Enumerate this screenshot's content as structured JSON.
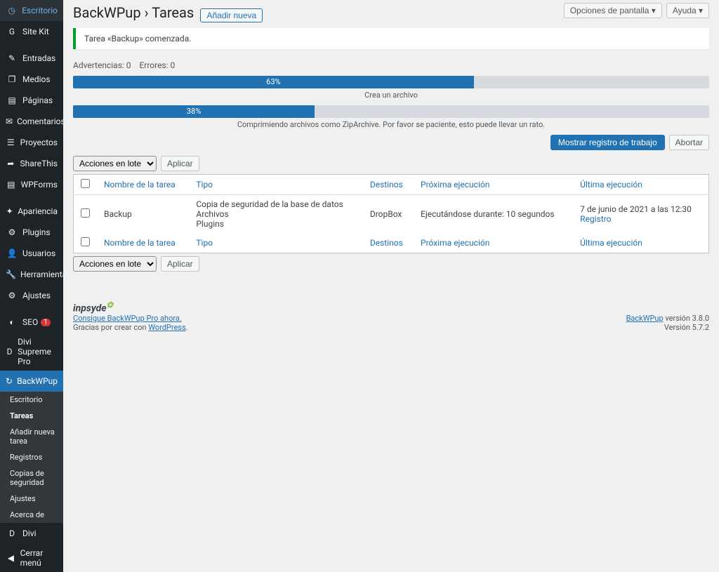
{
  "topbar": {
    "screen_options": "Opciones de pantalla",
    "help": "Ayuda"
  },
  "header": {
    "plugin": "BackWPup",
    "separator": "›",
    "page": "Tareas",
    "add_new": "Añadir nueva"
  },
  "notice": "Tarea «Backup» comenzada.",
  "stats": {
    "warnings_label": "Advertencias:",
    "warnings_count": "0",
    "errors_label": "Errores:",
    "errors_count": "0"
  },
  "progress1": {
    "percent": "63%",
    "caption": "Crea un archivo"
  },
  "progress2": {
    "percent": "38%",
    "caption": "Comprimiendo archivos como ZipArchive. Por favor se paciente, esto puede llevar un rato."
  },
  "job_actions": {
    "show_log": "Mostrar registro de trabajo",
    "abort": "Abortar"
  },
  "bulk": {
    "placeholder": "Acciones en lote",
    "apply": "Aplicar"
  },
  "table": {
    "cols": {
      "name": "Nombre de la tarea",
      "type": "Tipo",
      "dest": "Destinos",
      "next": "Próxima ejecución",
      "last": "Última ejecución"
    },
    "row": {
      "name": "Backup",
      "type1": "Copia de seguridad de la base de datos",
      "type2": "Archivos",
      "type3": "Plugins",
      "dest": "DropBox",
      "next": "Ejecutándose durante: 10 segundos",
      "last_date": "7 de junio de 2021 a las 12:30",
      "last_log": "Registro"
    }
  },
  "sidebar": {
    "items": [
      {
        "icon": "◷",
        "label": "Escritorio"
      },
      {
        "icon": "G",
        "label": "Site Kit"
      },
      {
        "icon": "✎",
        "label": "Entradas"
      },
      {
        "icon": "❐",
        "label": "Medios"
      },
      {
        "icon": "▤",
        "label": "Páginas"
      },
      {
        "icon": "✉",
        "label": "Comentarios"
      },
      {
        "icon": "☰",
        "label": "Proyectos"
      },
      {
        "icon": "➦",
        "label": "ShareThis"
      },
      {
        "icon": "▤",
        "label": "WPForms"
      },
      {
        "icon": "✦",
        "label": "Apariencia"
      },
      {
        "icon": "⚙",
        "label": "Plugins"
      },
      {
        "icon": "👤",
        "label": "Usuarios"
      },
      {
        "icon": "🔧",
        "label": "Herramientas"
      },
      {
        "icon": "⚙",
        "label": "Ajustes"
      },
      {
        "icon": "◐",
        "label": "SEO",
        "badge": "1"
      },
      {
        "icon": "D",
        "label": "Divi Supreme Pro"
      },
      {
        "icon": "↻",
        "label": "BackWPup",
        "current": true
      },
      {
        "icon": "D",
        "label": "Divi"
      },
      {
        "icon": "◀",
        "label": "Cerrar menú"
      }
    ],
    "submenu": [
      "Escritorio",
      "Tareas",
      "Añadir nueva tarea",
      "Registros",
      "Copias de seguridad",
      "Ajustes",
      "Acerca de"
    ]
  },
  "footer": {
    "logo": "inpsyde",
    "promo": "Consigue BackWPup Pro ahora.",
    "thanks_pre": "Gracias por crear con ",
    "thanks_link": "WordPress",
    "version_plugin_pre": "BackWPup",
    "version_plugin": " versión 3.8.0",
    "version_wp": "Versión 5.7.2"
  }
}
